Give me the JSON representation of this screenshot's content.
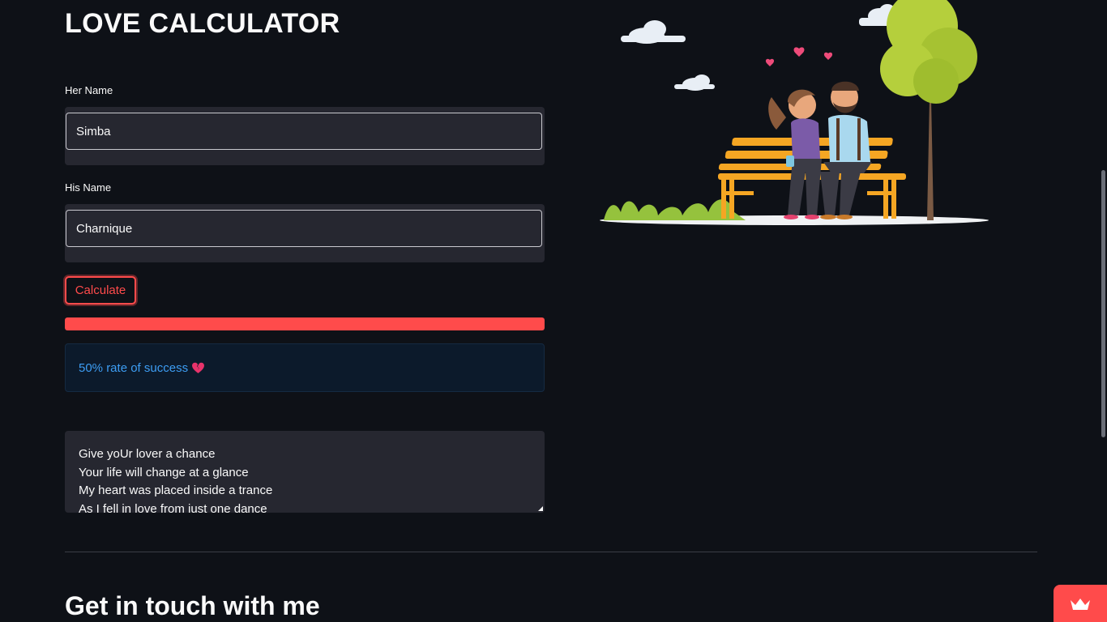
{
  "page": {
    "title": "LOVE CALCULATOR",
    "accent_color": "#ff4b4b",
    "background_color": "#0e1117"
  },
  "form": {
    "her_label": "Her Name",
    "her_value": "Simba",
    "his_label": "His Name",
    "his_value": "Charnique",
    "calculate_label": "Calculate"
  },
  "result": {
    "progress_percent": 100,
    "message": "50% rate of success",
    "icon": "broken-heart-icon"
  },
  "poem": {
    "lines": [
      "Give yoUr lover a chance",
      "Your life will change at a glance",
      "My heart was placed inside a trance",
      "As I fell in love from just one dance"
    ]
  },
  "contact": {
    "heading": "Get in touch with me"
  },
  "illustration": {
    "icon": "couple-on-bench-illustration"
  },
  "badge": {
    "icon": "crown-icon"
  }
}
